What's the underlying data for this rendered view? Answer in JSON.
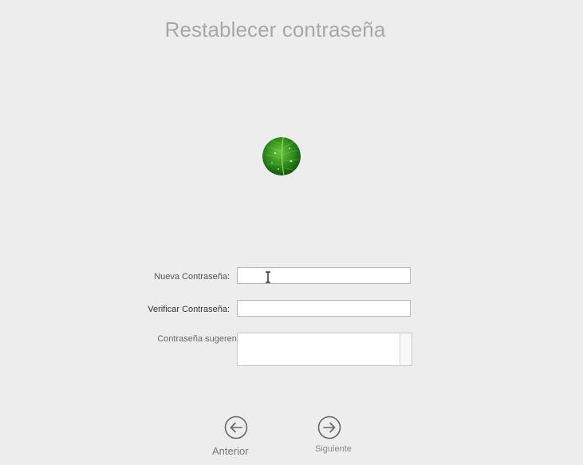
{
  "header": {
    "title": "Restablecer contraseña"
  },
  "form": {
    "new_password_label": "Nueva Contraseña:",
    "new_password_value": "",
    "verify_password_label": "Verificar Contraseña:",
    "verify_password_value": "",
    "hint_label": "Contraseña sugerencia:",
    "hint_value": ""
  },
  "navigation": {
    "back_label": "Anterior",
    "next_label": "Siguiente"
  },
  "colors": {
    "background": "#ededed",
    "title": "#a8a8a8",
    "avatar_leaf": "#2e8a1e"
  },
  "icons": {
    "avatar": "green-leaf-avatar",
    "back": "arrow-left-circle-icon",
    "next": "arrow-right-circle-icon"
  }
}
